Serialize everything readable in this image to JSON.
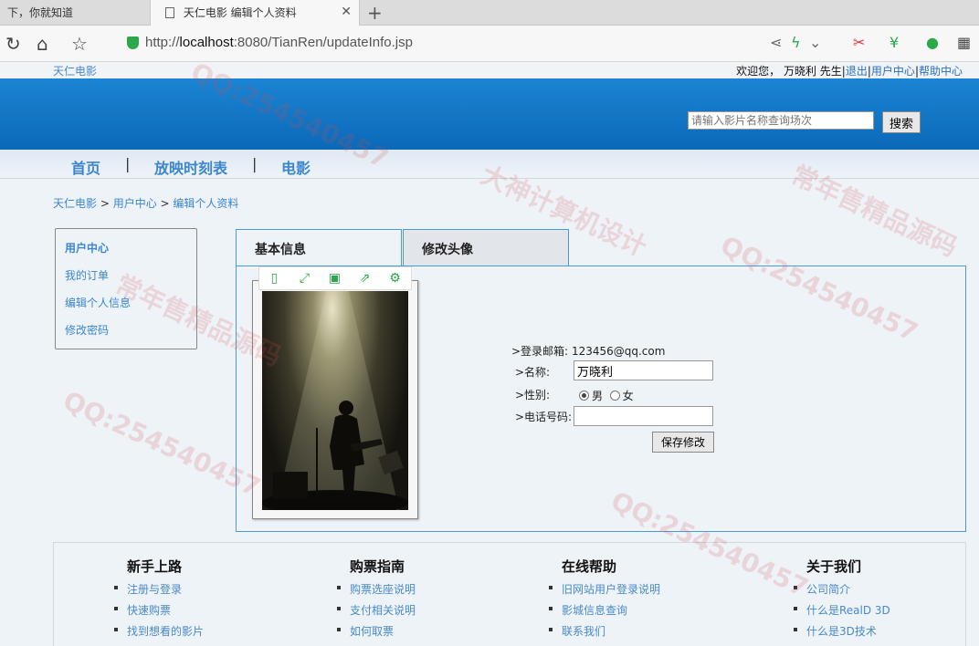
{
  "browser": {
    "tabs": [
      {
        "label": "下，你就知道"
      },
      {
        "label": "天仁电影 编辑个人资料"
      }
    ],
    "url_prefix": "http://",
    "url_host": "localhost",
    "url_rest": ":8080/TianRen/updateInfo.jsp"
  },
  "site": {
    "brand": "天仁电影",
    "welcome_text": "欢迎您， 万晓利 先生|",
    "logout": "退出",
    "user_center": "用户中心",
    "help_center": "帮助中心",
    "search_placeholder": "请输入影片名称查询场次",
    "search_button": "搜索",
    "nav": [
      "首页",
      "放映时刻表",
      "电影"
    ],
    "breadcrumb": [
      "天仁电影",
      "用户中心",
      "编辑个人资料"
    ],
    "sidebar": [
      "用户中心",
      "我的订单",
      "编辑个人信息",
      "修改密码"
    ]
  },
  "profile": {
    "tabs": [
      "基本信息",
      "修改头像"
    ],
    "email_label": ">登录邮箱:",
    "email_value": "123456@qq.com",
    "name_label": ">名称:",
    "name_value": "万晓利",
    "gender_label": ">性别:",
    "gender_options": [
      "男",
      "女"
    ],
    "gender_selected": "男",
    "phone_label": ">电话号码:",
    "phone_value": "",
    "save_button": "保存修改"
  },
  "footer": {
    "columns": [
      {
        "title": "新手上路",
        "items": [
          "注册与登录",
          "快速购票",
          "找到想看的影片"
        ]
      },
      {
        "title": "购票指南",
        "items": [
          "购票选座说明",
          "支付相关说明",
          "如何取票"
        ]
      },
      {
        "title": "在线帮助",
        "items": [
          "旧网站用户登录说明",
          "影城信息查询",
          "联系我们"
        ]
      },
      {
        "title": "关于我们",
        "items": [
          "公司简介",
          "什么是RealD 3D",
          "什么是3D技术"
        ]
      }
    ]
  },
  "watermarks": [
    "QQ:254540457",
    "大神计算机设计",
    "常年售精品源码"
  ]
}
